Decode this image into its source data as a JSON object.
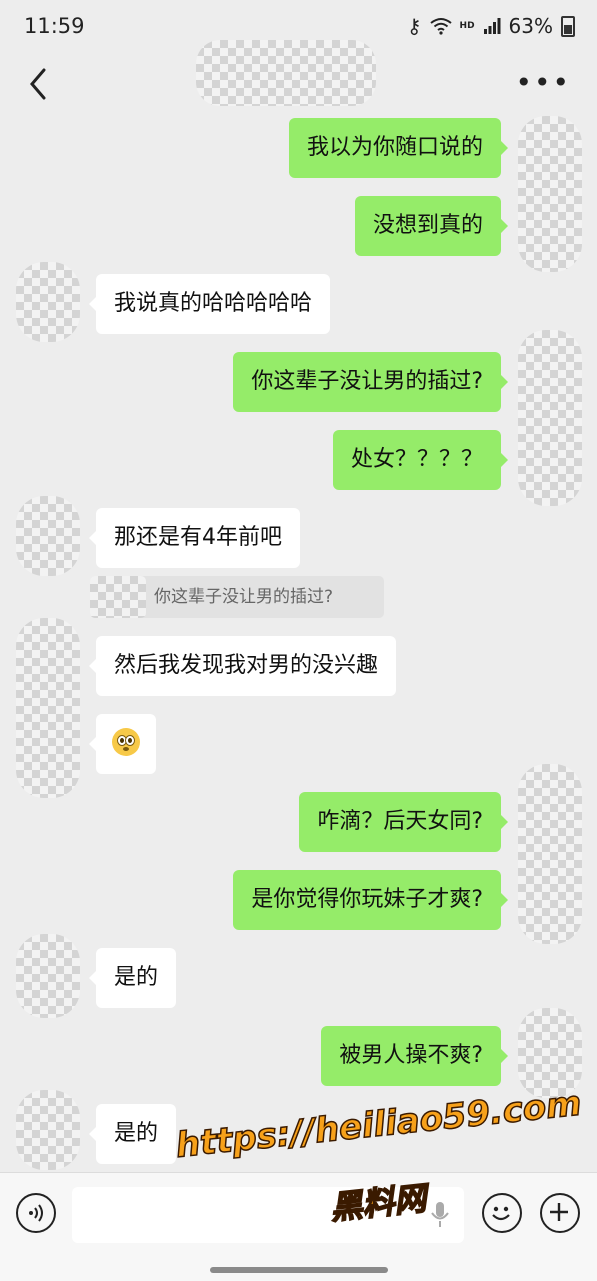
{
  "status_bar": {
    "time": "11:59",
    "battery": "63%",
    "network": "HD"
  },
  "header": {
    "back_icon": "chevron-left-icon",
    "more_icon": "more-horizontal-icon"
  },
  "messages": [
    {
      "side": "out",
      "text": "我以为你随口说的"
    },
    {
      "side": "out",
      "text": "没想到真的"
    },
    {
      "side": "in",
      "text": "我说真的哈哈哈哈哈"
    },
    {
      "side": "out",
      "text": "你这辈子没让男的插过?"
    },
    {
      "side": "out",
      "text": "处女？？？？"
    },
    {
      "side": "in",
      "text": "那还是有4年前吧"
    },
    {
      "side": "in",
      "text": "然后我发现我对男的没兴趣"
    },
    {
      "side": "in",
      "text": "",
      "emoji": "flushed-face"
    },
    {
      "side": "out",
      "text": "咋滴？后天女同?"
    },
    {
      "side": "out",
      "text": "是你觉得你玩妹子才爽?"
    },
    {
      "side": "in",
      "text": "是的"
    },
    {
      "side": "out",
      "text": "被男人操不爽?"
    },
    {
      "side": "in",
      "text": "是的"
    }
  ],
  "quote": {
    "text": "你这辈子没让男的插过?"
  },
  "bottom_bar": {
    "voice_icon": "voice-icon",
    "emoji_icon": "smile-icon",
    "plus_icon": "plus-icon"
  },
  "watermark": {
    "line1": "https://heiliao59.com",
    "line2": "黑料网"
  },
  "colors": {
    "outgoing_bubble": "#95ec69",
    "incoming_bubble": "#ffffff",
    "background": "#ededed",
    "watermark": "#f7a11a"
  }
}
